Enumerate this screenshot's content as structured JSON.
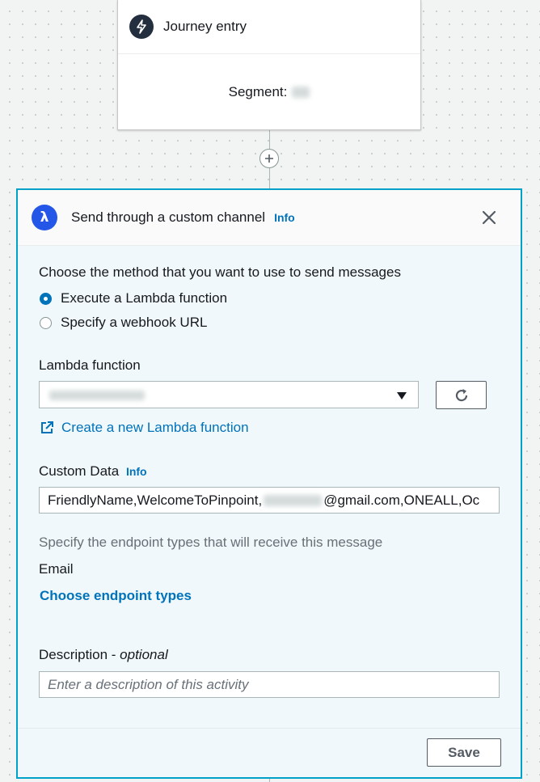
{
  "journey_entry": {
    "title": "Journey entry",
    "segment_label": "Segment:"
  },
  "panel": {
    "title": "Send through a custom channel",
    "info_label": "Info",
    "method_prompt": "Choose the method that you want to use to send messages",
    "method_options": [
      {
        "label": "Execute a Lambda function",
        "selected": true
      },
      {
        "label": "Specify a webhook URL",
        "selected": false
      }
    ],
    "lambda_label": "Lambda function",
    "create_lambda_link": "Create a new Lambda function",
    "custom_data_label": "Custom Data",
    "custom_data_info": "Info",
    "custom_data_value_prefix": "FriendlyName,WelcomeToPinpoint,",
    "custom_data_value_suffix": "@gmail.com,ONEALL,Oc",
    "endpoint_hint": "Specify the endpoint types that will receive this message",
    "endpoint_type": "Email",
    "choose_endpoint_link": "Choose endpoint types",
    "description_label": "Description",
    "description_optional": "optional",
    "description_placeholder": "Enter a description of this activity",
    "save_label": "Save"
  },
  "colors": {
    "accent": "#0073bb",
    "panel_border": "#00a1c9",
    "lambda_badge": "#2456e8"
  }
}
